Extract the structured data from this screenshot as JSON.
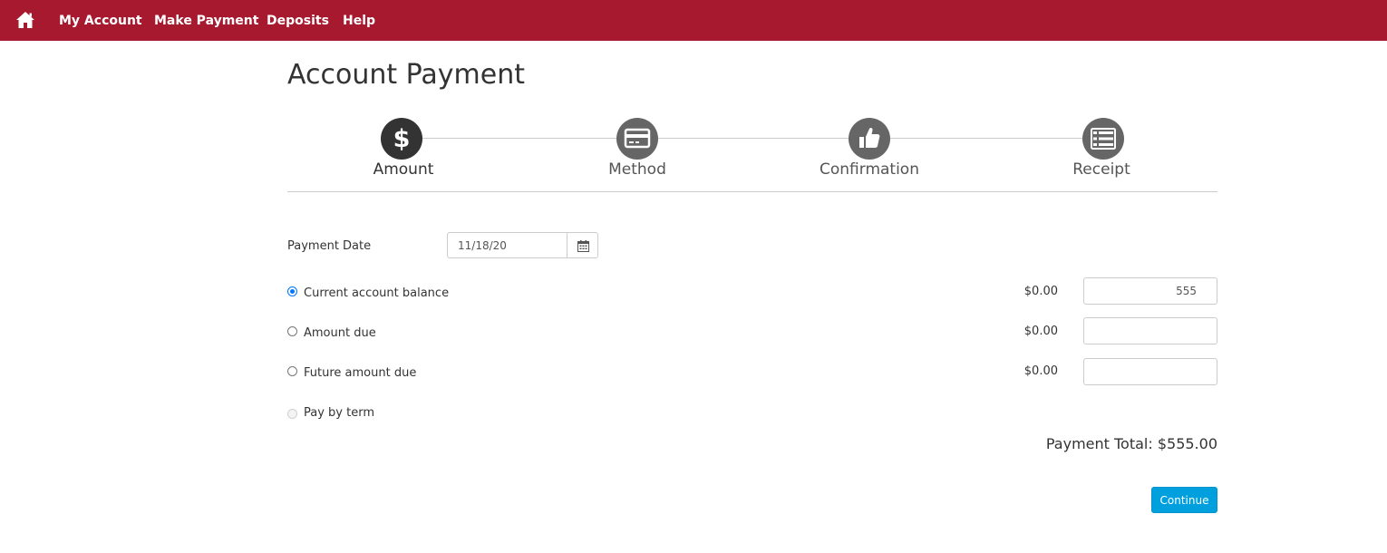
{
  "nav": {
    "home_icon": "home-icon",
    "items": [
      {
        "label": "My Account"
      },
      {
        "label": "Make Payment"
      },
      {
        "label": "Deposits"
      },
      {
        "label": "Help"
      }
    ]
  },
  "page": {
    "title": "Account Payment"
  },
  "steps": [
    {
      "label": "Amount",
      "icon": "dollar-icon",
      "active": true
    },
    {
      "label": "Method",
      "icon": "credit-card-icon",
      "active": false
    },
    {
      "label": "Confirmation",
      "icon": "thumbs-up-icon",
      "active": false
    },
    {
      "label": "Receipt",
      "icon": "list-icon",
      "active": false
    }
  ],
  "form": {
    "payment_date_label": "Payment Date",
    "payment_date_value": "11/18/20",
    "calendar_icon": "calendar-icon",
    "options": [
      {
        "label": "Current account balance",
        "balance": "$0.00",
        "amount": "555",
        "checked": true
      },
      {
        "label": "Amount due",
        "balance": "$0.00",
        "amount": "",
        "checked": false
      },
      {
        "label": "Future amount due",
        "balance": "$0.00",
        "amount": "",
        "checked": false
      },
      {
        "label": "Pay by term",
        "checked": false,
        "disabled": true
      }
    ],
    "payment_total": "Payment Total: $555.00",
    "continue_label": "Continue"
  },
  "colors": {
    "nav_background": "#a6192e",
    "active_step": "#333333",
    "inactive_step": "#666666",
    "primary_button": "#00a0df",
    "radio_selected": "#0075ff"
  }
}
